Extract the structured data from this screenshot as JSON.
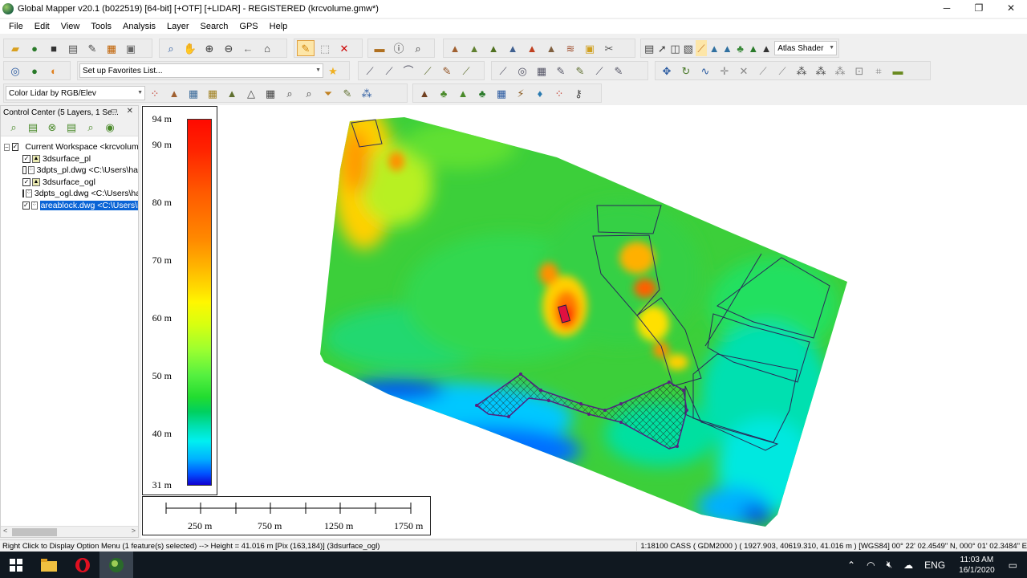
{
  "window": {
    "title": "Global Mapper v20.1 (b022519) [64-bit] [+OTF] [+LIDAR] - REGISTERED (krcvolume.gmw*)",
    "minimize": "─",
    "restore": "❐",
    "close": "✕"
  },
  "menu": [
    "File",
    "Edit",
    "View",
    "Tools",
    "Analysis",
    "Layer",
    "Search",
    "GPS",
    "Help"
  ],
  "toolbar": {
    "shader_select": "Atlas Shader",
    "favorites_select": "Set up Favorites List...",
    "lidar_color_select": "Color Lidar by RGB/Elev"
  },
  "control_center": {
    "title": "Control Center (5 Layers, 1 Se...",
    "header_buttons": "▭ ✕",
    "workspace": "Current Workspace <krcvolum",
    "layers": [
      {
        "label": "3dsurface_pl",
        "checked": true,
        "icon": "raster-layer-icon"
      },
      {
        "label": "3dpts_pl.dwg <C:\\Users\\ha",
        "checked": false,
        "icon": "vector-layer-icon"
      },
      {
        "label": "3dsurface_ogl",
        "checked": true,
        "icon": "raster-layer-icon"
      },
      {
        "label": "3dpts_ogl.dwg <C:\\Users\\ha",
        "checked": false,
        "icon": "vector-layer-icon"
      },
      {
        "label": "areablock.dwg <C:\\Users\\ha",
        "checked": true,
        "icon": "vector-layer-icon",
        "selected": true
      }
    ],
    "scroll_left": "<",
    "scroll_right": ">"
  },
  "legend": {
    "labels": [
      "94 m",
      "90 m",
      "80 m",
      "70 m",
      "60 m",
      "50 m",
      "40 m",
      "31 m"
    ],
    "range": [
      31,
      94
    ]
  },
  "scale_bar": {
    "labels": [
      "250 m",
      "750 m",
      "1250 m",
      "1750 m"
    ]
  },
  "status": {
    "left": "Right Click to Display Option Menu (1 feature(s) selected) --> Height = 41.016 m [Pix (163,184)] (3dsurface_ogl)",
    "right": "1:18100  CASS ( GDM2000 ) ( 1927.903, 40619.310, 41.016 m ) [WGS84] 00° 22' 02.4549\" N, 000° 01' 02.3484\" E"
  },
  "taskbar": {
    "lang": "ENG",
    "time": "11:03 AM",
    "date": "16/1/2020",
    "tray_up": "⌃"
  },
  "colors": {
    "selection": "#0a64d6",
    "taskbar": "#101820"
  }
}
